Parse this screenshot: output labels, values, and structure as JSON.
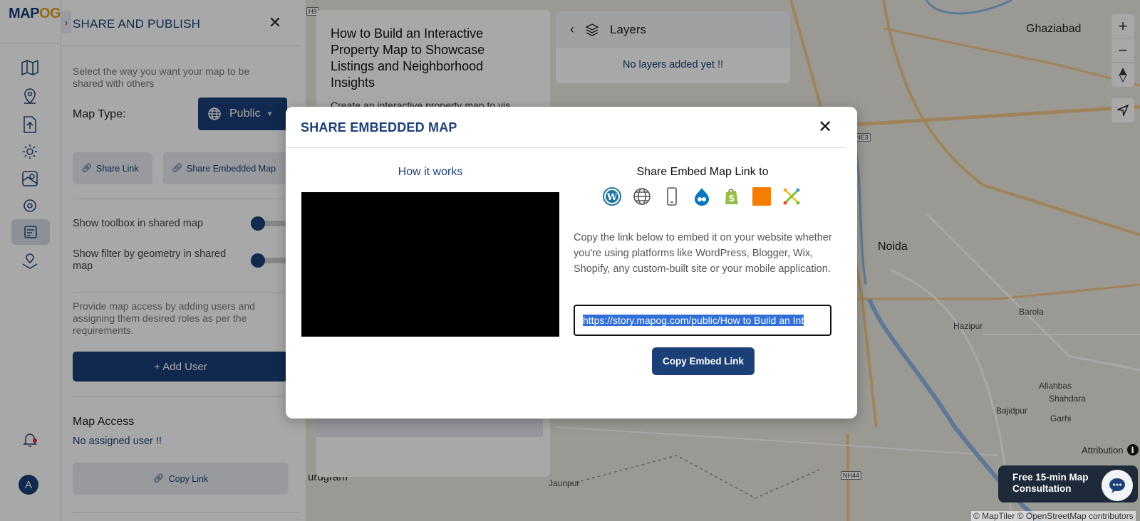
{
  "app": {
    "logo_main": "MAP",
    "logo_accent": "OG"
  },
  "panel": {
    "title": "SHARE AND PUBLISH",
    "close_glyph": "✕",
    "expand_glyph": "›",
    "intro": "Select the way you want your map to be shared with others",
    "map_type_label": "Map Type:",
    "map_type_value": "Public",
    "share_link_label": "Share Link",
    "share_embedded_label": "Share Embedded Map",
    "toolbox_label": "Show toolbox in shared map",
    "filter_label": "Show filter by geometry in shared map",
    "access_help": "Provide map access by adding users and assigning them desired roles as per the requirements.",
    "add_user_label": "+ Add User",
    "map_access_title": "Map Access",
    "no_assigned": "No assigned user !!",
    "copy_link_label": "Copy Link"
  },
  "user": {
    "avatar_initial": "A"
  },
  "story": {
    "title": "How to Build an Interactive Property Map to Showcase Listings and Neighborhood Insights",
    "subtitle_fragment": "Create an interactive property map to vis..."
  },
  "layers": {
    "title": "Layers",
    "empty": "No layers added yet !!"
  },
  "map": {
    "places": {
      "ghaziabad": "Ghaziabad",
      "noida": "Noida",
      "barola": "Barola",
      "hazipur": "Hazipur",
      "allahbas": "Allahbas",
      "shahdara": "Shahdara",
      "bajidpur": "Bajidpur",
      "garhi": "Garhi",
      "jaunpur": "Jaunpur",
      "gurugram": "urugram"
    },
    "shields": {
      "h9": "H9",
      "ne3": "NE3",
      "nh44": "NH44"
    },
    "zoom_in": "+",
    "zoom_out": "−",
    "attribution": "Attribution",
    "attribution_icon": "i",
    "copyright": "© MapTiler © OpenStreetMap contributors",
    "consultation": "Free 15-min Map Consultation"
  },
  "modal": {
    "title": "SHARE EMBEDDED MAP",
    "close_glyph": "✕",
    "how_it_works": "How it works",
    "share_to": "Share Embed Map Link to",
    "platform_icons": [
      "wordpress-icon",
      "globe-icon",
      "mobile-icon",
      "drupal-icon",
      "shopify-icon",
      "blogger-icon",
      "joomla-icon"
    ],
    "description": "Copy the link below to embed it on your website whether you're using platforms like WordPress, Blogger, Wix, Shopify, any custom-built site or your mobile application.",
    "embed_url": "https://story.mapog.com/public/How to Build an Int",
    "copy_embed_label": "Copy Embed Link"
  },
  "colors": {
    "primary": "#1b3f77",
    "accent": "#e0a21a",
    "blogger": "#f57d00"
  }
}
